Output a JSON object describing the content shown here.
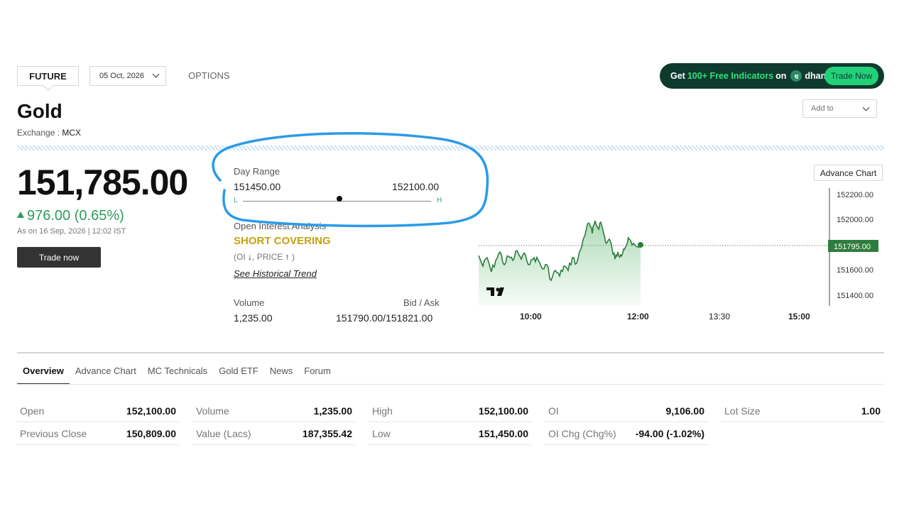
{
  "top_bar": {
    "future_tab": "FUTURE",
    "expiry_date": "05 Oct, 2026",
    "options_tab": "OPTIONS",
    "promo": {
      "prefix": "Get",
      "highlight": "100+ Free Indicators",
      "on_text": "on",
      "logo_glyph": "ध",
      "brand": "dhan",
      "button": "Trade Now"
    },
    "add_to": "Add to"
  },
  "instrument": {
    "name": "Gold",
    "exchange_label": "Exchange :",
    "exchange": "MCX"
  },
  "price": {
    "ltp": "151,785.00",
    "change": "976.00 (0.65%)",
    "as_on": "As on 16 Sep, 2026 | 12:02 IST",
    "trade_button": "Trade now",
    "direction": "up",
    "color_up": "#2e9b5a"
  },
  "day_range": {
    "label": "Day Range",
    "low": "151450.00",
    "high": "152100.00",
    "low_marker": "L",
    "high_marker": "H",
    "current_position": 0.52
  },
  "open_interest": {
    "label": "Open Interest Analysis",
    "signal": "SHORT COVERING",
    "note_prefix": "(OI",
    "note_middle": ", PRICE",
    "note_suffix": ")",
    "oi_arrow_icon": "arrow-down-icon",
    "price_arrow_icon": "arrow-up-icon",
    "historical_link": "See Historical Trend"
  },
  "volume_bid": {
    "volume_label": "Volume",
    "volume": "1,235.00",
    "bidask_label": "Bid / Ask",
    "bidask": "151790.00/151821.00"
  },
  "chart": {
    "advance_button": "Advance Chart",
    "y_ticks": [
      "152200.00",
      "152000.00",
      "151600.00",
      "151400.00"
    ],
    "current_label": "151795.00",
    "x_ticks": [
      "10:00",
      "12:00",
      "13:30",
      "15:00"
    ],
    "line_color": "#2e7d3e",
    "price_tag_color": "#2e7d3e",
    "logo": "tradingview-logo-icon"
  },
  "tabs": [
    "Overview",
    "Advance Chart",
    "MC Technicals",
    "Gold ETF",
    "News",
    "Forum"
  ],
  "stats": [
    [
      {
        "k": "Open",
        "v": "152,100.00"
      },
      {
        "k": "Previous Close",
        "v": "150,809.00"
      }
    ],
    [
      {
        "k": "Volume",
        "v": "1,235.00"
      },
      {
        "k": "Value (Lacs)",
        "v": "187,355.42"
      }
    ],
    [
      {
        "k": "High",
        "v": "152,100.00"
      },
      {
        "k": "Low",
        "v": "151,450.00"
      }
    ],
    [
      {
        "k": "OI",
        "v": "9,106.00"
      },
      {
        "k": "OI Chg (Chg%)",
        "v": "-94.00 (-1.02%)"
      }
    ],
    [
      {
        "k": "Lot Size",
        "v": "1.00"
      }
    ]
  ]
}
